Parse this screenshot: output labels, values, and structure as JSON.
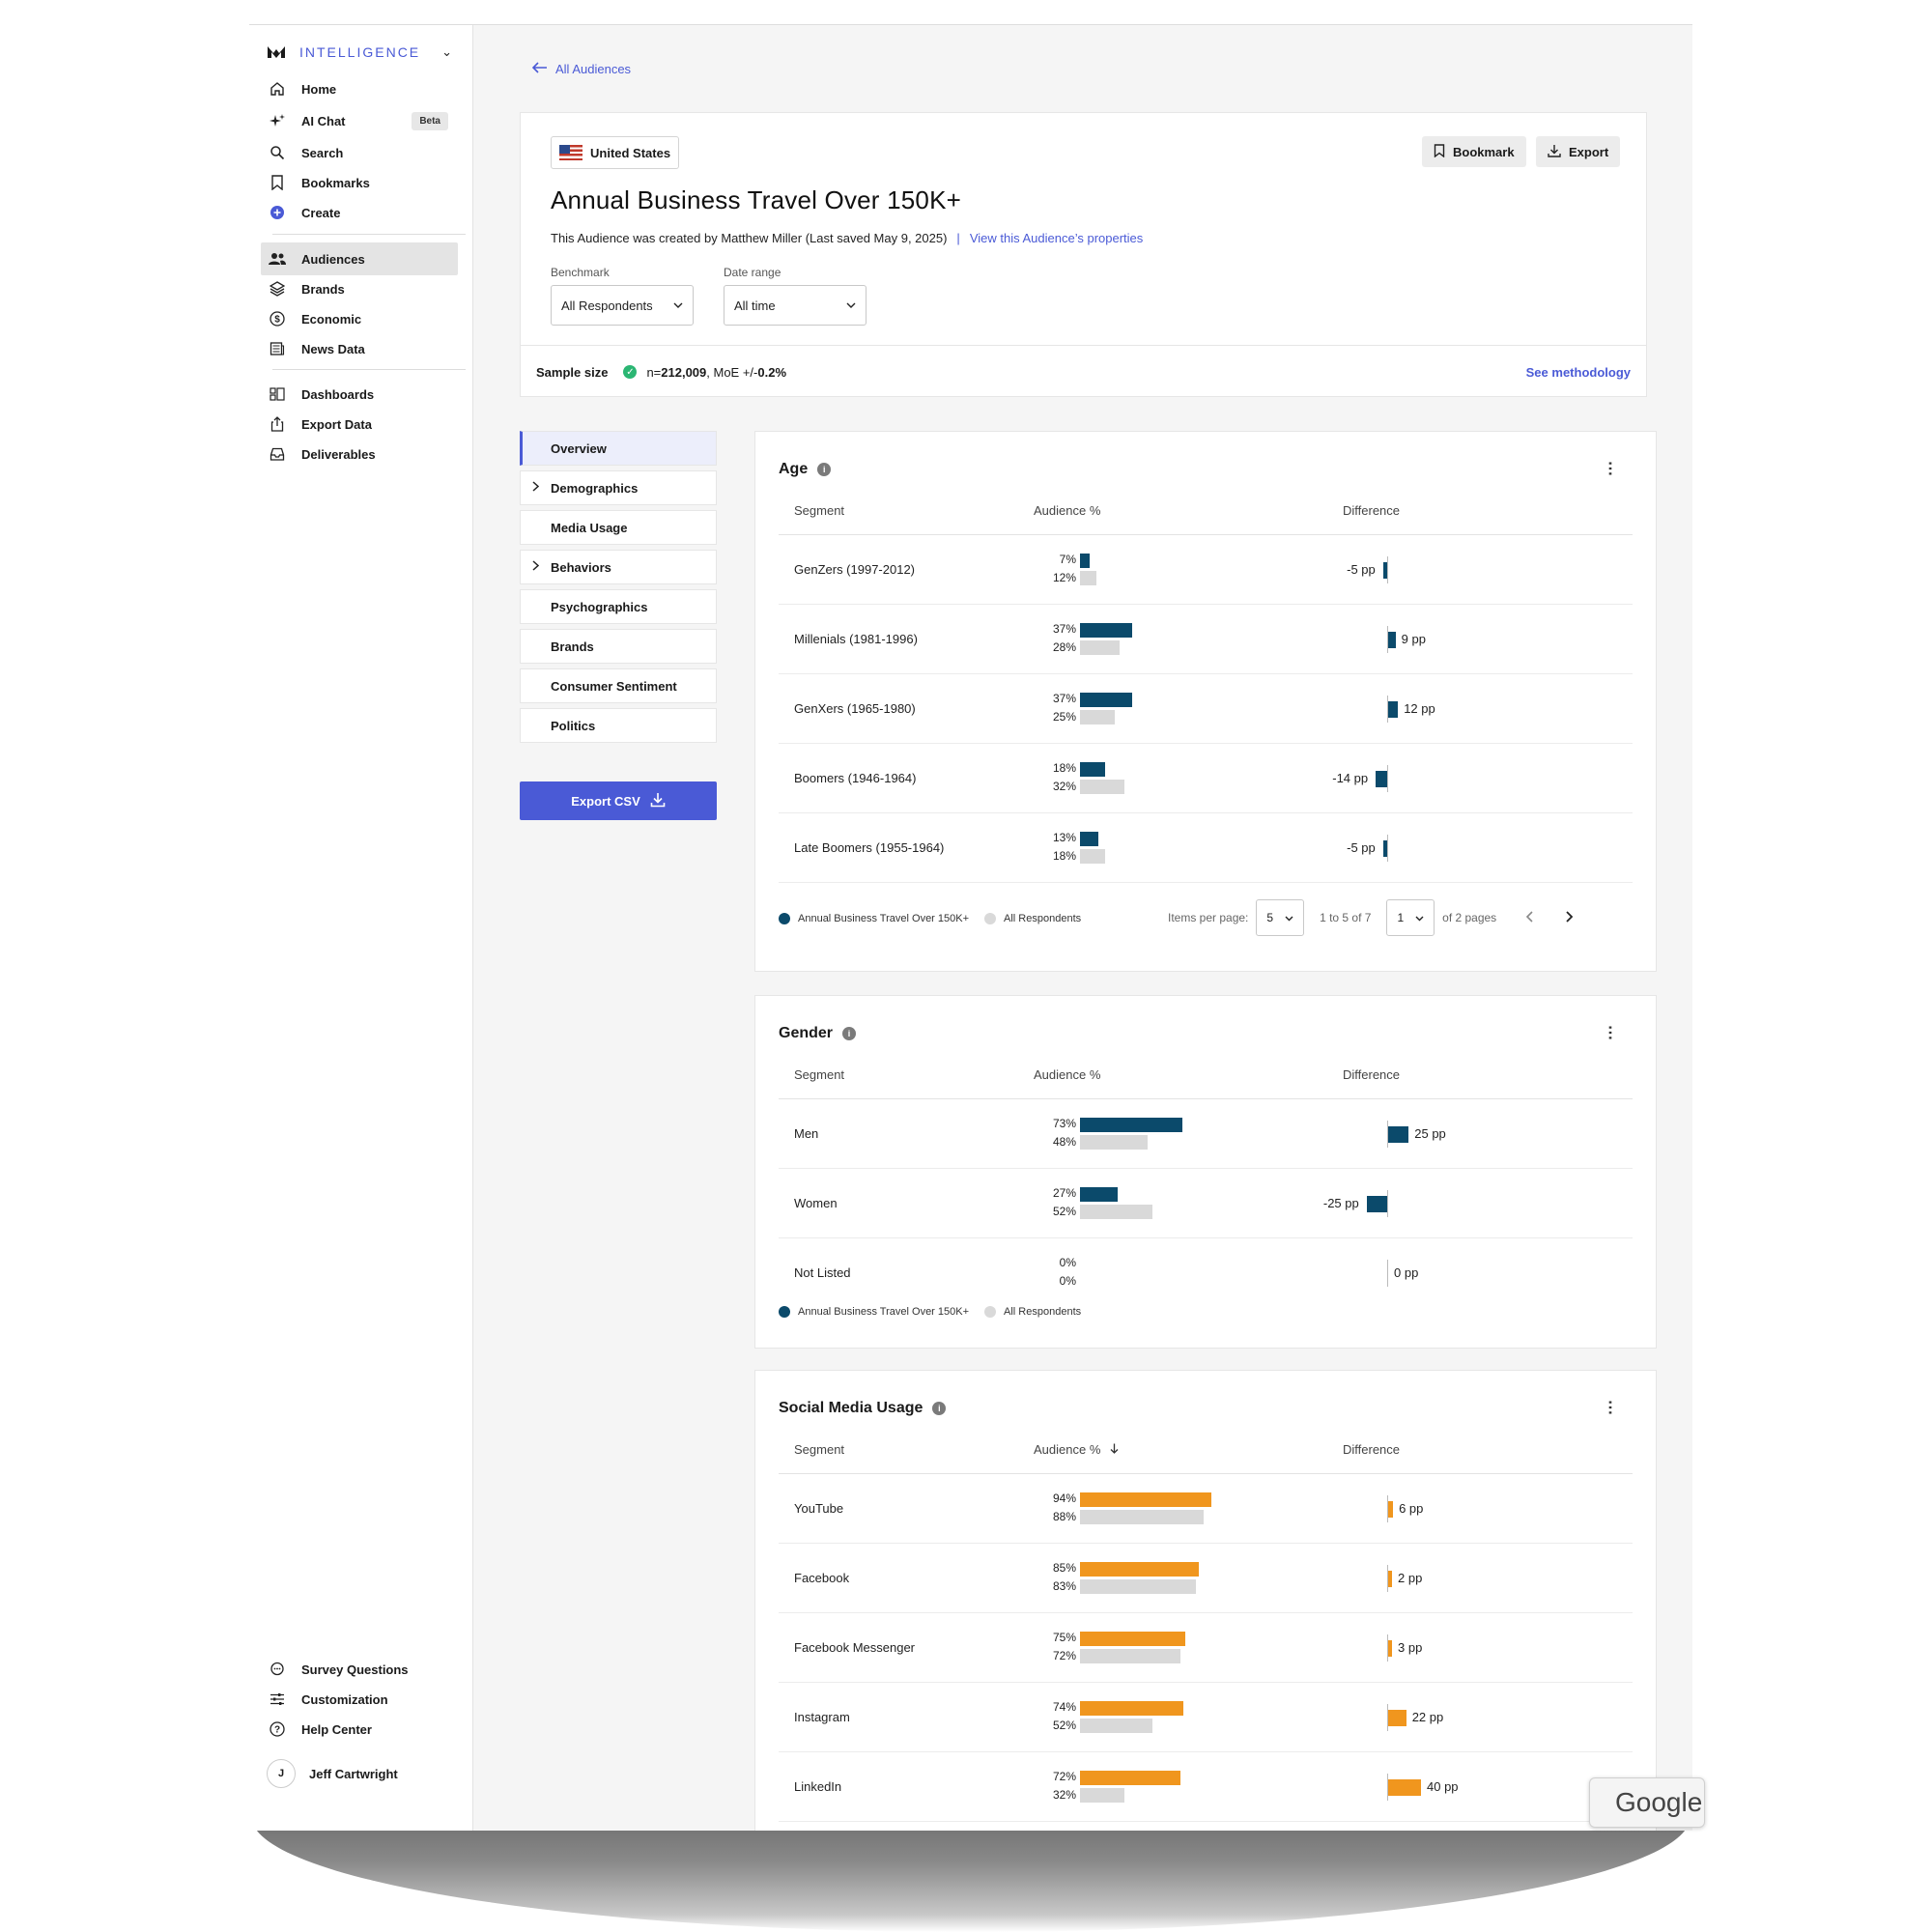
{
  "brand": {
    "name": "INTELLIGENCE"
  },
  "sidebar": {
    "items": [
      {
        "label": "Home",
        "icon": "home-icon"
      },
      {
        "label": "AI Chat",
        "icon": "sparkle-icon",
        "badge": "Beta"
      },
      {
        "label": "Search",
        "icon": "search-icon"
      },
      {
        "label": "Bookmarks",
        "icon": "bookmark-icon"
      },
      {
        "label": "Create",
        "icon": "plus-circle-icon"
      },
      {
        "label": "Audiences",
        "icon": "people-icon",
        "active": true
      },
      {
        "label": "Brands",
        "icon": "layers-icon"
      },
      {
        "label": "Economic",
        "icon": "dollar-icon"
      },
      {
        "label": "News Data",
        "icon": "newspaper-icon"
      },
      {
        "label": "Dashboards",
        "icon": "dashboard-icon"
      },
      {
        "label": "Export Data",
        "icon": "export-icon"
      },
      {
        "label": "Deliverables",
        "icon": "inbox-icon"
      },
      {
        "label": "Survey Questions",
        "icon": "chat-bubble-icon"
      },
      {
        "label": "Customization",
        "icon": "sliders-icon"
      },
      {
        "label": "Help Center",
        "icon": "help-icon"
      }
    ],
    "user": {
      "initial": "J",
      "name": "Jeff Cartwright"
    }
  },
  "header": {
    "back_label": "All Audiences",
    "country": "United States",
    "bookmark_label": "Bookmark",
    "export_label": "Export",
    "title": "Annual Business Travel Over 150K+",
    "subtitle": "This Audience was created by Matthew Miller (Last saved May 9, 2025)",
    "pipe": "|",
    "properties_link": "View this Audience’s properties",
    "benchmark_label": "Benchmark",
    "benchmark_value": "All Respondents",
    "date_range_label": "Date range",
    "date_range_value": "All time",
    "sample_label": "Sample size",
    "sample_n_prefix": "n=",
    "sample_n": "212,009",
    "sample_moe_prefix": ", MoE +/- ",
    "sample_moe": "0.2%",
    "methodology_link": "See methodology"
  },
  "section_nav": {
    "items": [
      {
        "label": "Overview",
        "active": true,
        "expandable": false
      },
      {
        "label": "Demographics",
        "expandable": true
      },
      {
        "label": "Media Usage",
        "expandable": false
      },
      {
        "label": "Behaviors",
        "expandable": true
      },
      {
        "label": "Psychographics",
        "expandable": false
      },
      {
        "label": "Brands",
        "expandable": false
      },
      {
        "label": "Consumer Sentiment",
        "expandable": false
      },
      {
        "label": "Politics",
        "expandable": false
      }
    ],
    "export_csv_label": "Export CSV"
  },
  "colors": {
    "audience_dark": "#0b4a6b",
    "benchmark": "#d9d9d9",
    "social": "#f0961e",
    "accent": "#4a5ad6"
  },
  "columns": {
    "segment": "Segment",
    "audience": "Audience %",
    "difference": "Difference"
  },
  "age": {
    "title": "Age",
    "rows": [
      {
        "segment": "GenZers (1997-2012)",
        "audience": 7,
        "benchmark": 12,
        "diff": -5,
        "audience_label": "7%",
        "benchmark_label": "12%",
        "diff_label": "-5 pp"
      },
      {
        "segment": "Millenials (1981-1996)",
        "audience": 37,
        "benchmark": 28,
        "diff": 9,
        "audience_label": "37%",
        "benchmark_label": "28%",
        "diff_label": "9 pp"
      },
      {
        "segment": "GenXers (1965-1980)",
        "audience": 37,
        "benchmark": 25,
        "diff": 12,
        "audience_label": "37%",
        "benchmark_label": "25%",
        "diff_label": "12 pp"
      },
      {
        "segment": "Boomers (1946-1964)",
        "audience": 18,
        "benchmark": 32,
        "diff": -14,
        "audience_label": "18%",
        "benchmark_label": "32%",
        "diff_label": "-14 pp"
      },
      {
        "segment": "Late Boomers (1955-1964)",
        "audience": 13,
        "benchmark": 18,
        "diff": -5,
        "audience_label": "13%",
        "benchmark_label": "18%",
        "diff_label": "-5 pp"
      }
    ],
    "pagination": {
      "items_per_page_label": "Items per page:",
      "items_per_page": "5",
      "range": "1 to 5 of 7",
      "page": "1",
      "of_pages": "of 2 pages"
    }
  },
  "gender": {
    "title": "Gender",
    "rows": [
      {
        "segment": "Men",
        "audience": 73,
        "benchmark": 48,
        "diff": 25,
        "audience_label": "73%",
        "benchmark_label": "48%",
        "diff_label": "25 pp"
      },
      {
        "segment": "Women",
        "audience": 27,
        "benchmark": 52,
        "diff": -25,
        "audience_label": "27%",
        "benchmark_label": "52%",
        "diff_label": "-25 pp"
      },
      {
        "segment": "Not Listed",
        "audience": 0,
        "benchmark": 0,
        "diff": 0,
        "audience_label": "0%",
        "benchmark_label": "0%",
        "diff_label": "0 pp"
      }
    ]
  },
  "social": {
    "title": "Social Media Usage",
    "rows": [
      {
        "segment": "YouTube",
        "audience": 94,
        "benchmark": 88,
        "diff": 6,
        "audience_label": "94%",
        "benchmark_label": "88%",
        "diff_label": "6 pp"
      },
      {
        "segment": "Facebook",
        "audience": 85,
        "benchmark": 83,
        "diff": 2,
        "audience_label": "85%",
        "benchmark_label": "83%",
        "diff_label": "2 pp"
      },
      {
        "segment": "Facebook Messenger",
        "audience": 75,
        "benchmark": 72,
        "diff": 3,
        "audience_label": "75%",
        "benchmark_label": "72%",
        "diff_label": "3 pp"
      },
      {
        "segment": "Instagram",
        "audience": 74,
        "benchmark": 52,
        "diff": 22,
        "audience_label": "74%",
        "benchmark_label": "52%",
        "diff_label": "22 pp"
      },
      {
        "segment": "LinkedIn",
        "audience": 72,
        "benchmark": 32,
        "diff": 40,
        "audience_label": "72%",
        "benchmark_label": "32%",
        "diff_label": "40 pp"
      }
    ]
  },
  "legend": {
    "audience": "Annual Business Travel Over 150K+",
    "benchmark": "All Respondents"
  },
  "overlay": {
    "google_label": "Google"
  }
}
